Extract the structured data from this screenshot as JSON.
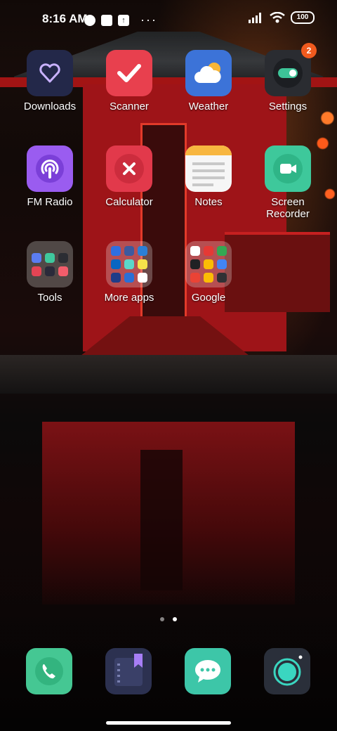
{
  "status_bar": {
    "time": "8:16 AM",
    "battery": "100",
    "more": "···"
  },
  "apps": [
    {
      "label": "Downloads",
      "icon": "heart-icon",
      "color": "#262b5a"
    },
    {
      "label": "Scanner",
      "icon": "checkmark-icon",
      "color": "#e9404e"
    },
    {
      "label": "Weather",
      "icon": "cloud-sun-icon",
      "color": "#3d74d6"
    },
    {
      "label": "Settings",
      "icon": "toggle-icon",
      "color": "#2a2c31",
      "badge": "2"
    },
    {
      "label": "FM Radio",
      "icon": "radio-icon",
      "color": "#9b5cf0"
    },
    {
      "label": "Calculator",
      "icon": "close-x-icon",
      "color": "#e3394a"
    },
    {
      "label": "Notes",
      "icon": "notes-icon",
      "color": "#f4f4f4"
    },
    {
      "label": "Screen\nRecorder",
      "icon": "video-camera-icon",
      "color": "#3ec79a"
    },
    {
      "label": "Tools",
      "icon": "folder-icon"
    },
    {
      "label": "More apps",
      "icon": "folder-icon"
    },
    {
      "label": "Google",
      "icon": "folder-icon"
    }
  ],
  "dock": [
    {
      "name": "phone",
      "icon": "phone-icon",
      "color": "#45c793"
    },
    {
      "name": "notes",
      "icon": "bookmark-icon",
      "color": "#2c3150"
    },
    {
      "name": "messages",
      "icon": "chat-bubble-icon",
      "color": "#3dc6a8"
    },
    {
      "name": "camera",
      "icon": "camera-lens-icon",
      "color": "#2a2f3a"
    }
  ],
  "pages": {
    "count": 2,
    "active": 2
  }
}
